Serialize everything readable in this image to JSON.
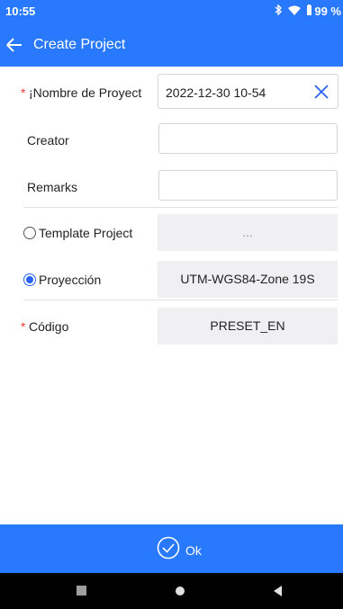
{
  "status": {
    "time": "10:55",
    "battery": "99 %",
    "bluetooth_icon": "bluetooth-icon",
    "wifi_icon": "wifi-icon",
    "battery_icon": "battery-icon"
  },
  "appbar": {
    "title": "Create Project",
    "back_icon": "arrow-left-icon"
  },
  "form": {
    "project_name": {
      "required": "*",
      "label": "¡Nombre de Proyect",
      "value": "2022-12-30 10-54"
    },
    "creator": {
      "label": "Creator",
      "value": ""
    },
    "remarks": {
      "label": "Remarks",
      "value": ""
    },
    "template": {
      "label": "Template Project",
      "value": "...",
      "selected": false
    },
    "projection": {
      "label": "Proyección",
      "value": "UTM-WGS84-Zone 19S",
      "selected": true
    },
    "code": {
      "required": "*",
      "label": "Código",
      "value": "PRESET_EN"
    }
  },
  "footer": {
    "ok_label": "Ok",
    "ok_icon": "check-circle-icon"
  },
  "navbar": {
    "icons": [
      "recents-icon",
      "home-icon",
      "back-icon"
    ]
  },
  "colors": {
    "primary": "#2979ff",
    "required": "#e53935",
    "field_gray": "#f0f0f2"
  }
}
